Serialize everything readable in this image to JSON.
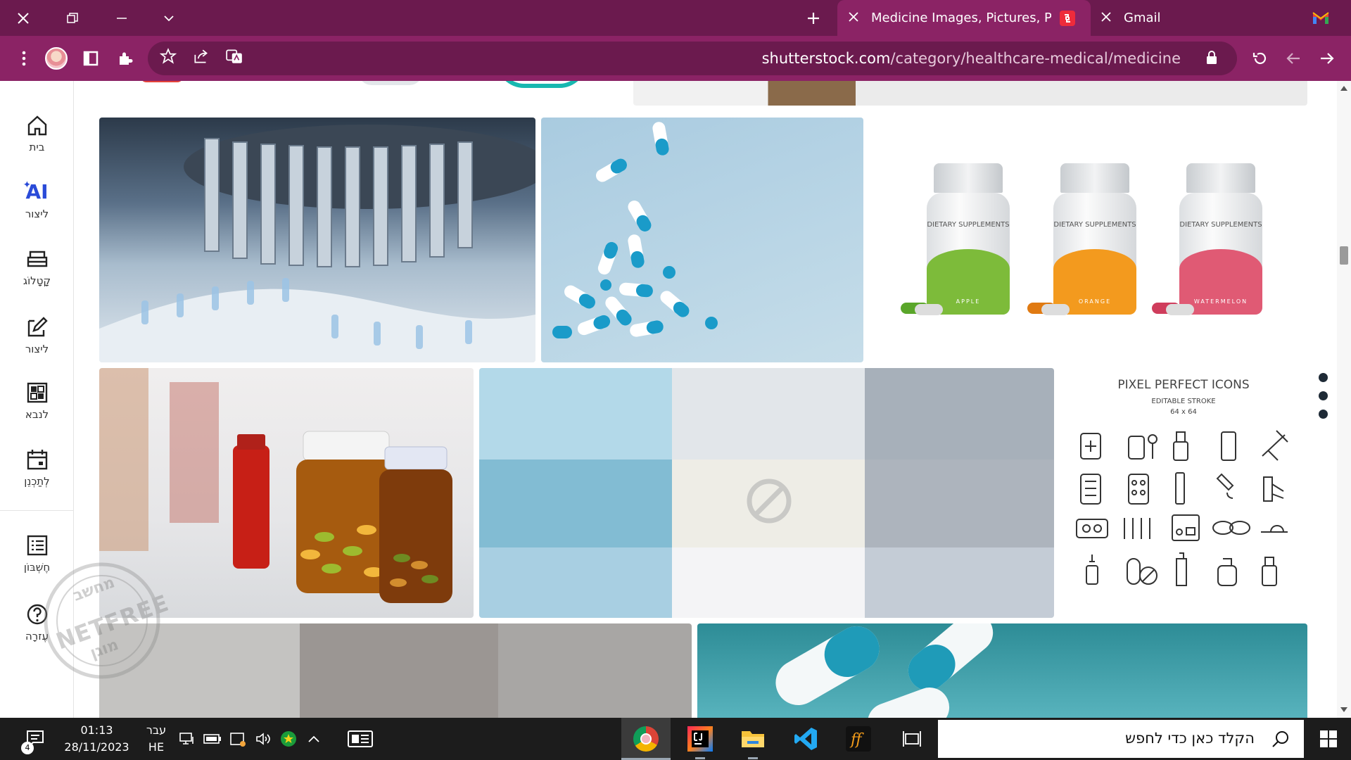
{
  "browser": {
    "tabs": [
      {
        "title": "Medicine Images, Pictures, Photo",
        "active": true
      },
      {
        "title": "Gmail",
        "active": false
      }
    ],
    "url_domain": "shutterstock.com",
    "url_path": "/category/healthcare-medical/medicine"
  },
  "sidebar": {
    "items": [
      {
        "label": "בית",
        "icon": "home-icon"
      },
      {
        "label": "ליצור",
        "icon": "ai-icon",
        "ai_text": "AI"
      },
      {
        "label": "קָטָלוֹג",
        "icon": "catalog-icon"
      },
      {
        "label": "ליצור",
        "icon": "edit-icon"
      },
      {
        "label": "לנבא",
        "icon": "dashboard-icon"
      },
      {
        "label": "לְתַכְנֵן",
        "icon": "calendar-icon"
      },
      {
        "label": "חֶשְׁבּוֹן",
        "icon": "account-icon"
      },
      {
        "label": "עֶזרָה",
        "icon": "help-icon"
      }
    ]
  },
  "tiles": {
    "supplements": {
      "bottle_title": "DIETARY SUPPLEMENTS",
      "flavors": [
        "APPLE",
        "ORANGE",
        "WATERMELON"
      ],
      "colors": [
        "#7dbb3a",
        "#f39a1e",
        "#e05a74"
      ]
    },
    "icons_tile": {
      "title": "PIXEL PERFECT ICONS",
      "subtitle": "EDITABLE STROKE",
      "size": "64 x 64"
    },
    "watermark": {
      "top": "מחשב",
      "middle": "NETFREE",
      "bottom": "מוגן"
    }
  },
  "taskbar": {
    "search_placeholder": "הקלד כאן כדי לחפש",
    "time": "01:13",
    "date": "28/11/2023",
    "lang_top": "עבר",
    "lang_bottom": "HE",
    "notification_count": "4"
  },
  "colors": {
    "titlebar": "#6b1a4e",
    "toolbar": "#8b2365",
    "taskbar": "#1c1c1c"
  }
}
